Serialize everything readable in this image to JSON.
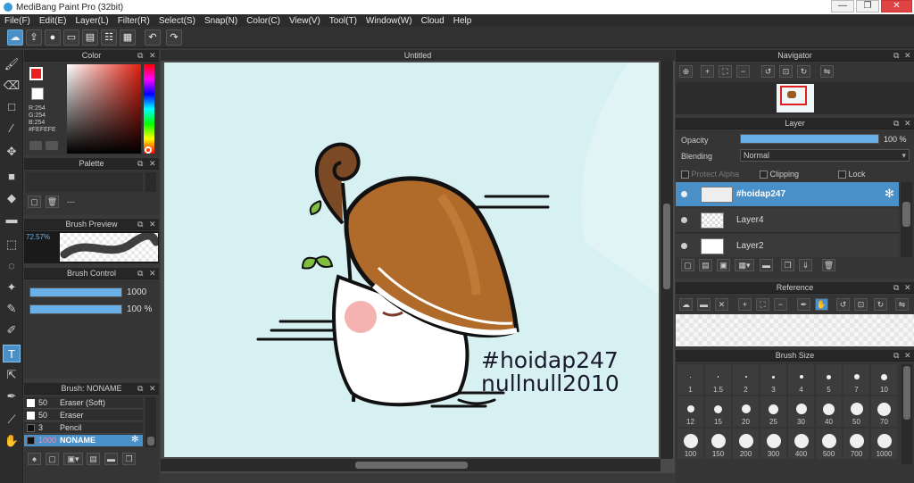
{
  "window": {
    "title": "MediBang Paint Pro (32bit)",
    "minimize": "—",
    "maximize": "❐",
    "close": "✕"
  },
  "menu": [
    "File(F)",
    "Edit(E)",
    "Layer(L)",
    "Filter(R)",
    "Select(S)",
    "Snap(N)",
    "Color(C)",
    "View(V)",
    "Tool(T)",
    "Window(W)",
    "Cloud",
    "Help"
  ],
  "toolbar_icons": [
    "cloud-icon",
    "upload-icon",
    "comment-icon",
    "chat-icon",
    "document-icon",
    "list-icon",
    "grid-icon",
    "undo-icon",
    "redo-icon"
  ],
  "tools": {
    "brush": "🖌",
    "eraser": "⌫",
    "selection": "□",
    "line": "∕",
    "move": "✥",
    "fill": "■",
    "bucket": "◆",
    "gradient": "▬",
    "marquee": "⬚",
    "lasso": "◌",
    "magicwand": "✦",
    "selectpen": "✎",
    "selecteraser": "✐",
    "text": "T",
    "operation": "⇱",
    "eyedropper": "✒",
    "pipette": "⟋",
    "hand": "✋"
  },
  "color": {
    "title": "Color",
    "current": "#FF0000",
    "secondary": "#FEFEFE",
    "r": "R:254",
    "g": "G:254",
    "b": "B:254",
    "hex": "#FEFEFE"
  },
  "palette": {
    "title": "Palette",
    "label": "---"
  },
  "brush_preview": {
    "title": "Brush Preview",
    "percent": "72.57%"
  },
  "brush_control": {
    "title": "Brush Control",
    "size_value": "1000",
    "opacity_value": "100 %",
    "size_fill": 1.0,
    "opacity_fill": 1.0
  },
  "brush_list": {
    "title": "Brush: NONAME",
    "items": [
      {
        "size": "50",
        "name": "Eraser (Soft)",
        "selected": false
      },
      {
        "size": "50",
        "name": "Eraser",
        "selected": false
      },
      {
        "size": "3",
        "name": "Pencil",
        "selected": false
      },
      {
        "size": "1000",
        "name": "NONAME",
        "selected": true
      }
    ]
  },
  "canvas": {
    "tab": "Untitled",
    "text1": "#hoidap247",
    "text2": "nullnull2010"
  },
  "navigator": {
    "title": "Navigator"
  },
  "layer": {
    "title": "Layer",
    "opacity_label": "Opacity",
    "opacity_value": "100 %",
    "opacity_fill": 1.0,
    "blending_label": "Blending",
    "blending_value": "Normal",
    "protect_alpha": "Protect Alpha",
    "clipping": "Clipping",
    "lock": "Lock",
    "layers": [
      {
        "name": "#hoidap247",
        "selected": true
      },
      {
        "name": "Layer4",
        "selected": false
      },
      {
        "name": "Layer2",
        "selected": false
      }
    ]
  },
  "reference": {
    "title": "Reference"
  },
  "brush_size": {
    "title": "Brush Size",
    "sizes": [
      "1",
      "1.5",
      "2",
      "3",
      "4",
      "5",
      "7",
      "10",
      "12",
      "15",
      "20",
      "25",
      "30",
      "40",
      "50",
      "70",
      "100",
      "150",
      "200",
      "300",
      "400",
      "500",
      "700",
      "1000"
    ]
  }
}
